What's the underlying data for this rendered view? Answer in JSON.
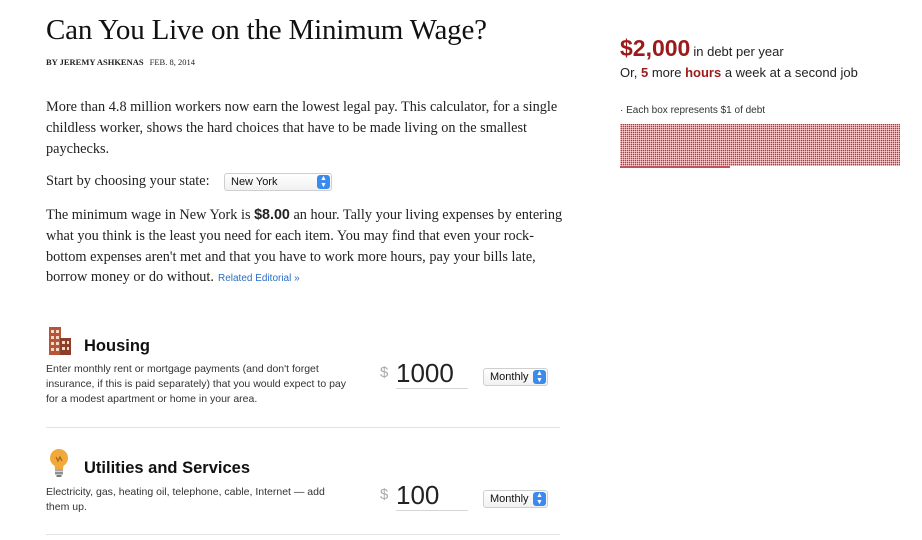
{
  "article": {
    "title": "Can You Live on the Minimum Wage?",
    "byline": "By JEREMY ASHKENAS",
    "date": "FEB. 8, 2014",
    "intro": "More than 4.8 million workers now earn the lowest legal pay. This calculator, for a single childless worker, shows the hard choices that have to be made living on the smallest paychecks.",
    "state_label": "Start by choosing your state:",
    "state_value": "New York",
    "wage_text_1": "The minimum wage in New York is",
    "wage_amount": "$8.00",
    "wage_text_2": "an hour. Tally your living expenses by entering what you think is the least you need for each item. You may find that even your rock-bottom expenses aren't met and that you have to work more hours, pay your bills late, borrow money or do without.",
    "related_link": "Related Editorial »"
  },
  "sections": [
    {
      "title": "Housing",
      "icon": "building-icon",
      "description": "Enter monthly rent or mortgage payments (and don't forget insurance, if this is paid separately) that you would expect to pay for a modest apartment or home in your area.",
      "currency": "$",
      "amount": "1000",
      "frequency": "Monthly"
    },
    {
      "title": "Utilities and Services",
      "icon": "lightbulb-icon",
      "description": "Electricity, gas, heating oil, telephone, cable, Internet — add them up.",
      "currency": "$",
      "amount": "100",
      "frequency": "Monthly"
    }
  ],
  "summary": {
    "debt_amount": "$2,000",
    "debt_suffix": "in debt per year",
    "hours_prefix": "Or,",
    "hours_value": "5",
    "hours_mid": "more",
    "hours_word": "hours",
    "hours_suffix": "a week at a second job",
    "box_legend": "· Each box represents $1 of debt"
  },
  "colors": {
    "accent_red": "#9b1a1a",
    "link_blue": "#2a6ec1",
    "select_blue": "#3b8bef"
  }
}
